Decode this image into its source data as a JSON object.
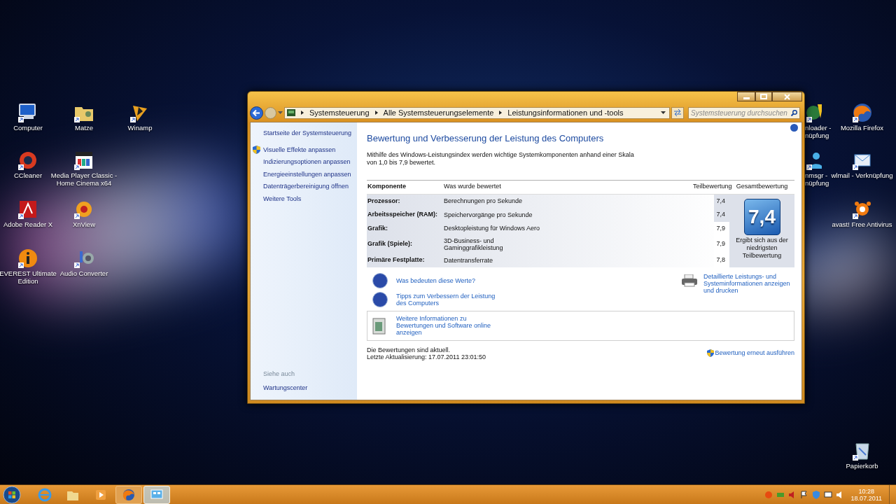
{
  "desktop_icons": [
    {
      "kind": "computer",
      "lines": [
        "Computer"
      ]
    },
    {
      "kind": "folder",
      "lines": [
        "Matze"
      ]
    },
    {
      "kind": "winamp",
      "lines": [
        "Winamp"
      ]
    },
    {
      "kind": "ccleaner",
      "lines": [
        "CCleaner"
      ]
    },
    {
      "kind": "mpc",
      "lines": [
        "Media Player Classic -",
        "Home Cinema x64"
      ]
    },
    {
      "kind": "pdf",
      "lines": [
        "Adobe Reader X"
      ]
    },
    {
      "kind": "xnview",
      "lines": [
        "XnView"
      ]
    },
    {
      "kind": "everest",
      "lines": [
        "EVEREST Ultimate",
        "Edition"
      ]
    },
    {
      "kind": "audio",
      "lines": [
        "Audio Converter"
      ]
    },
    {
      "kind": "downloader",
      "lines": [
        "nloader -",
        "nüpfung"
      ]
    },
    {
      "kind": "messenger",
      "lines": [
        "nmsgr -",
        "nüpfung"
      ]
    },
    {
      "kind": "firefox",
      "lines": [
        "Mozilla Firefox"
      ]
    },
    {
      "kind": "mail",
      "lines": [
        "wlmail - Verknüpfung"
      ]
    },
    {
      "kind": "avast",
      "lines": [
        "avast! Free Antivirus"
      ]
    },
    {
      "kind": "recycle",
      "lines": [
        "Papierkorb"
      ]
    }
  ],
  "window": {
    "address": {
      "breadcrumb": [
        "Systemsteuerung",
        "Alle Systemsteuerungselemente",
        "Leistungsinformationen und -tools"
      ],
      "search_placeholder": "Systemsteuerung durchsuchen"
    },
    "sidebar": {
      "home": "Startseite der Systemsteuerung",
      "tasks": [
        {
          "label": "Visuelle Effekte anpassen",
          "shield": true
        },
        {
          "label": "Indizierungsoptionen anpassen",
          "shield": false
        },
        {
          "label": "Energieeinstellungen anpassen",
          "shield": false
        },
        {
          "label": "Datenträgerbereinigung öffnen",
          "shield": false
        },
        {
          "label": "Weitere Tools",
          "shield": false
        }
      ],
      "see_also_title": "Siehe auch",
      "see_also": [
        "Wartungscenter"
      ]
    },
    "heading": "Bewertung und Verbesserung der Leistung des Computers",
    "intro": "Mithilfe des Windows-Leistungsindex werden wichtige Systemkomponenten anhand einer Skala von 1,0 bis 7,9 bewertet.",
    "table": {
      "columns": [
        "Komponente",
        "Was wurde bewertet",
        "Teilbewertung",
        "Gesamtbewertung"
      ],
      "rows": [
        {
          "component": "Prozessor:",
          "measured": "Berechnungen pro Sekunde",
          "score": "7,4",
          "lowest": true
        },
        {
          "component": "Arbeitsspeicher (RAM):",
          "measured": "Speichervorgänge pro Sekunde",
          "score": "7,4",
          "lowest": true
        },
        {
          "component": "Grafik:",
          "measured": "Desktopleistung für Windows Aero",
          "score": "7,9",
          "lowest": false
        },
        {
          "component": "Grafik (Spiele):",
          "measured": "3D-Business- und Gaminggrafikleistung",
          "score": "7,9",
          "lowest": false
        },
        {
          "component": "Primäre Festplatte:",
          "measured": "Datentransferrate",
          "score": "7,8",
          "lowest": false
        }
      ],
      "overall": {
        "score": "7,4",
        "caption": "Ergibt sich aus der niedrigsten Teilbewertung"
      }
    },
    "help_links": [
      "Was bedeuten diese Werte?",
      "Tipps zum Verbessern der Leistung des Computers"
    ],
    "print_link": "Detaillierte Leistungs- und Systeminformationen anzeigen und drucken",
    "online_link": "Weitere Informationen zu Bewertungen und Software online anzeigen",
    "status": [
      "Die Bewertungen sind aktuell.",
      "Letzte Aktualisierung: 17.07.2011 23:01:50"
    ],
    "rerun_link": "Bewertung erneut ausführen"
  },
  "taskbar": {
    "buttons": [
      {
        "kind": "ie",
        "selected": false
      },
      {
        "kind": "explorer",
        "selected": false
      },
      {
        "kind": "media",
        "selected": false
      },
      {
        "kind": "firefox",
        "selected": false
      },
      {
        "kind": "controlpanel",
        "selected": true
      }
    ],
    "clock": {
      "time": "10:28",
      "date": "18.07.2011"
    }
  }
}
